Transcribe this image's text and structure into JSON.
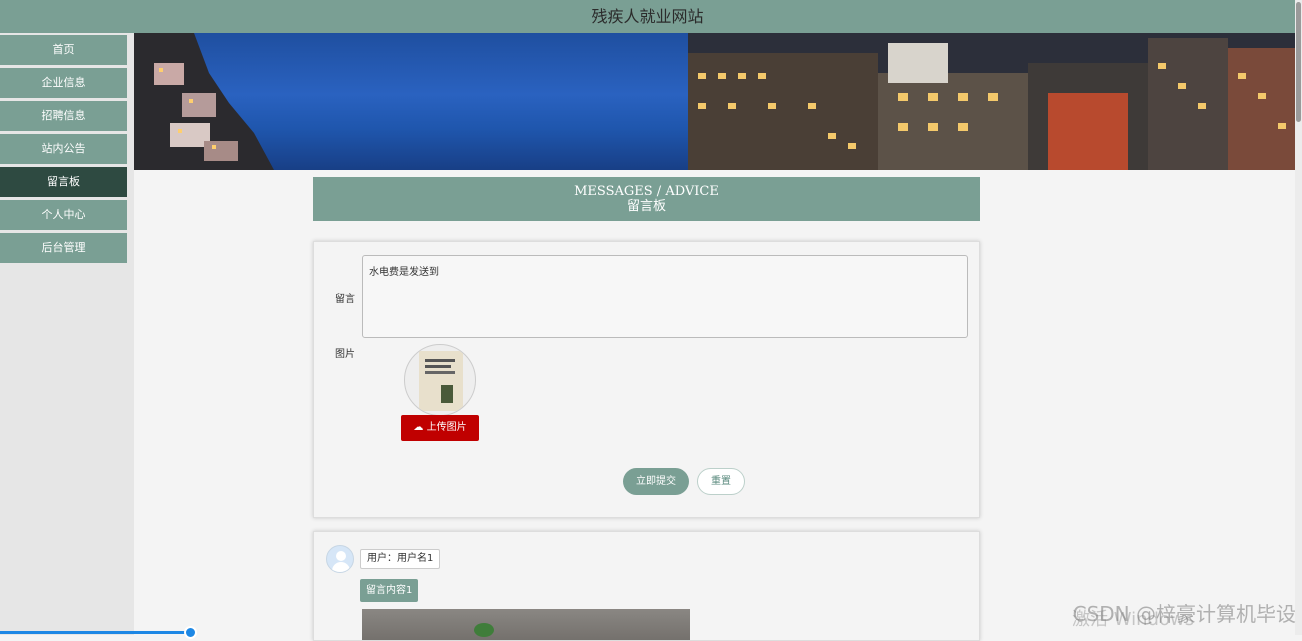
{
  "site": {
    "title": "残疾人就业网站"
  },
  "sidebar": {
    "items": [
      {
        "label": "首页",
        "active": false
      },
      {
        "label": "企业信息",
        "active": false
      },
      {
        "label": "招聘信息",
        "active": false
      },
      {
        "label": "站内公告",
        "active": false
      },
      {
        "label": "留言板",
        "active": true
      },
      {
        "label": "个人中心",
        "active": false
      },
      {
        "label": "后台管理",
        "active": false
      }
    ]
  },
  "section": {
    "title_en": "MESSAGES / ADVICE",
    "title_cn": "留言板"
  },
  "form": {
    "message_label": "留言",
    "message_value": "水电费是发送到",
    "image_label": "图片",
    "upload_label": "上传图片",
    "submit_label": "立即提交",
    "reset_label": "重置"
  },
  "messages": [
    {
      "user": "用户：用户名1",
      "content": "留言内容1"
    }
  ],
  "watermark": {
    "text": "CSDN @梓豪计算机毕设",
    "overlay": "激活 Windows"
  },
  "colors": {
    "accent": "#7a9f94",
    "active_nav": "#2e4a41",
    "upload": "#c00000",
    "progress": "#1e88e5"
  }
}
